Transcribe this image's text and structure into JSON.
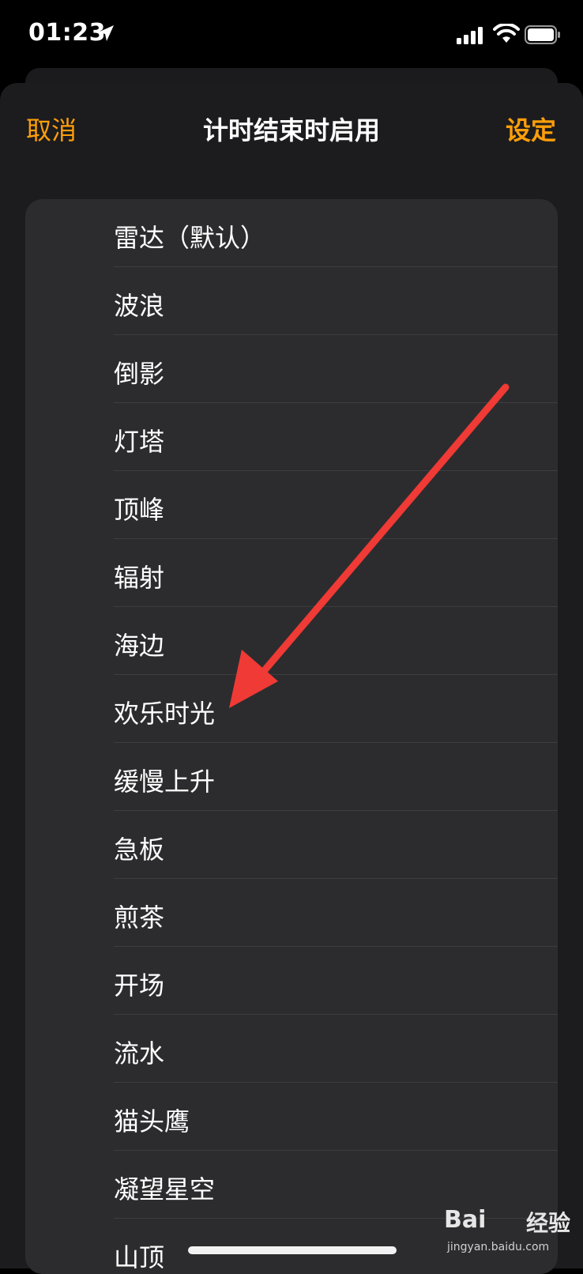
{
  "status_bar": {
    "time": "01:23"
  },
  "nav": {
    "cancel_label": "取消",
    "title": "计时结束时启用",
    "set_label": "设定"
  },
  "items": [
    "雷达（默认）",
    "波浪",
    "倒影",
    "灯塔",
    "顶峰",
    "辐射",
    "海边",
    "欢乐时光",
    "缓慢上升",
    "急板",
    "煎茶",
    "开场",
    "流水",
    "猫头鹰",
    "凝望星空",
    "山顶"
  ],
  "colors": {
    "accent": "#ff9f0a",
    "sheet_bg": "#1c1c1e",
    "list_bg": "#2c2c2e",
    "arrow": "#f03a35"
  },
  "watermark": {
    "brand": "Bai",
    "brand_cn": "经验",
    "url": "jingyan.baidu.com"
  }
}
